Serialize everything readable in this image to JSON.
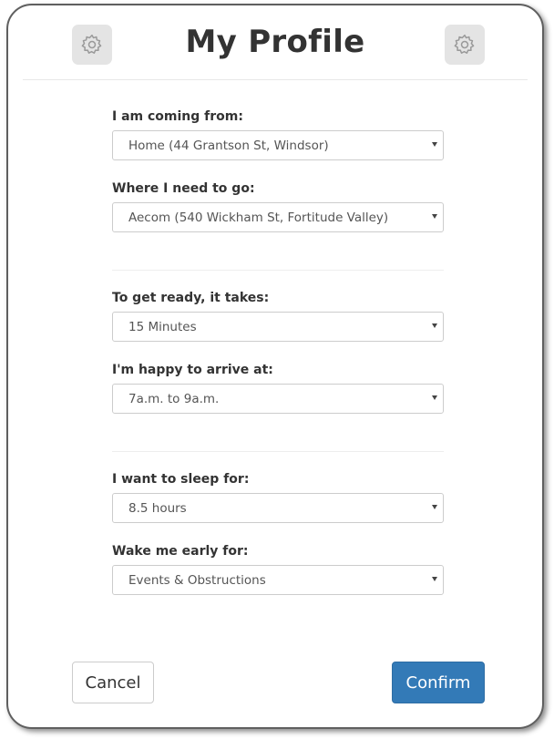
{
  "header": {
    "title": "My Profile",
    "left_icon": "gear-icon",
    "right_icon": "gear-icon"
  },
  "form": {
    "origin": {
      "label": "I am coming from:",
      "value": "Home (44 Grantson St, Windsor)"
    },
    "destination": {
      "label": "Where I need to go:",
      "value": "Aecom (540 Wickham St, Fortitude Valley)"
    },
    "ready_time": {
      "label": "To get ready, it takes:",
      "value": "15 Minutes"
    },
    "arrival_window": {
      "label": "I'm happy to arrive at:",
      "value": "7a.m. to 9a.m."
    },
    "sleep": {
      "label": "I want to sleep for:",
      "value": "8.5 hours"
    },
    "wake_early": {
      "label": "Wake me early for:",
      "value": "Events & Obstructions"
    }
  },
  "footer": {
    "cancel_label": "Cancel",
    "confirm_label": "Confirm"
  },
  "colors": {
    "primary": "#337ab7",
    "gear_bg": "#e4e4e4",
    "text": "#333333"
  }
}
